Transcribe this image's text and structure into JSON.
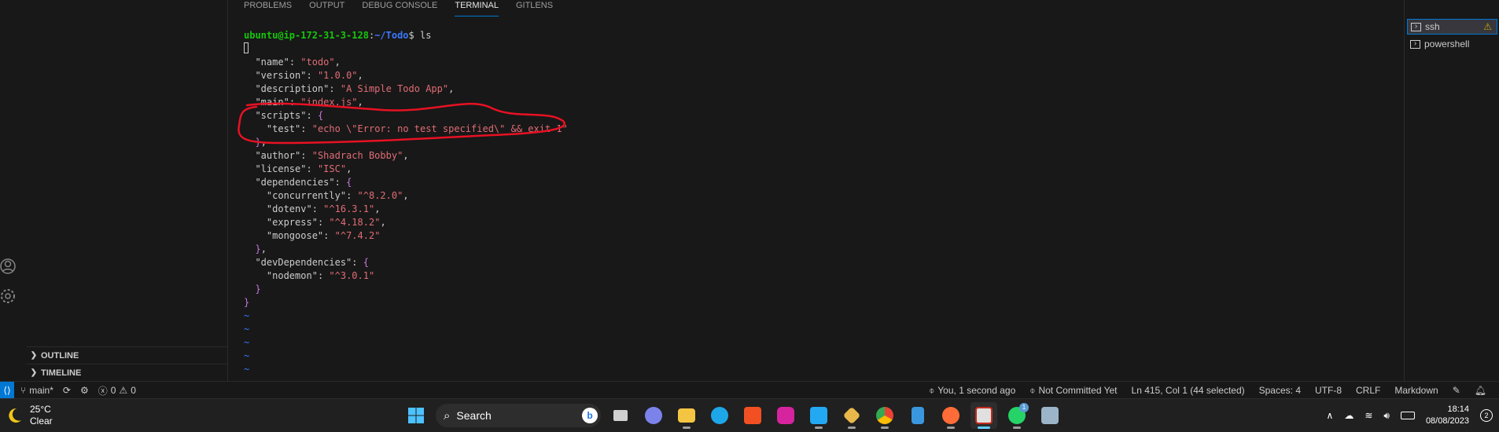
{
  "panel": {
    "tabs": [
      "PROBLEMS",
      "OUTPUT",
      "DEBUG CONSOLE",
      "TERMINAL",
      "GITLENS"
    ],
    "active_tab": "TERMINAL"
  },
  "sidebar": {
    "outline": "OUTLINE",
    "timeline": "TIMELINE"
  },
  "terminal": {
    "prompt_user": "ubuntu@ip-172-31-3-128",
    "prompt_path": "~/Todo",
    "command": "$ ls",
    "json": {
      "name": "todo",
      "version": "1.0.0",
      "description": "A Simple Todo App",
      "main": "index.js",
      "test": "echo \\\"Error: no test specified\\\" && exit 1",
      "author": "Shadrach Bobby",
      "license": "ISC",
      "dep_concurrently": "^8.2.0",
      "dep_dotenv": "^16.3.1",
      "dep_express": "^4.18.2",
      "dep_mongoose": "^7.4.2",
      "dev_nodemon": "^3.0.1"
    },
    "keys": {
      "name": "\"name\"",
      "version": "\"version\"",
      "description": "\"description\"",
      "main": "\"main\"",
      "scripts": "\"scripts\"",
      "test": "\"test\"",
      "author": "\"author\"",
      "license": "\"license\"",
      "dependencies": "\"dependencies\"",
      "concurrently": "\"concurrently\"",
      "dotenv": "\"dotenv\"",
      "express": "\"express\"",
      "mongoose": "\"mongoose\"",
      "devDependencies": "\"devDependencies\"",
      "nodemon": "\"nodemon\""
    }
  },
  "terminal_list": [
    {
      "label": "ssh",
      "active": true
    },
    {
      "label": "powershell",
      "active": false
    }
  ],
  "statusbar": {
    "branch": "main*",
    "problems": "0",
    "warnings": "0",
    "blame": "You, 1 second ago",
    "commit": "Not Committed Yet",
    "position": "Ln 415, Col 1 (44 selected)",
    "spaces": "Spaces: 4",
    "encoding": "UTF-8",
    "eol": "CRLF",
    "language": "Markdown"
  },
  "taskbar": {
    "temperature": "25°C",
    "condition": "Clear",
    "search_label": "Search",
    "time": "18:14",
    "date": "08/08/2023",
    "notifications": "2",
    "whatsapp_badge": "1"
  },
  "colors": {
    "accent": "#0078d4",
    "annotation": "#e81123"
  }
}
